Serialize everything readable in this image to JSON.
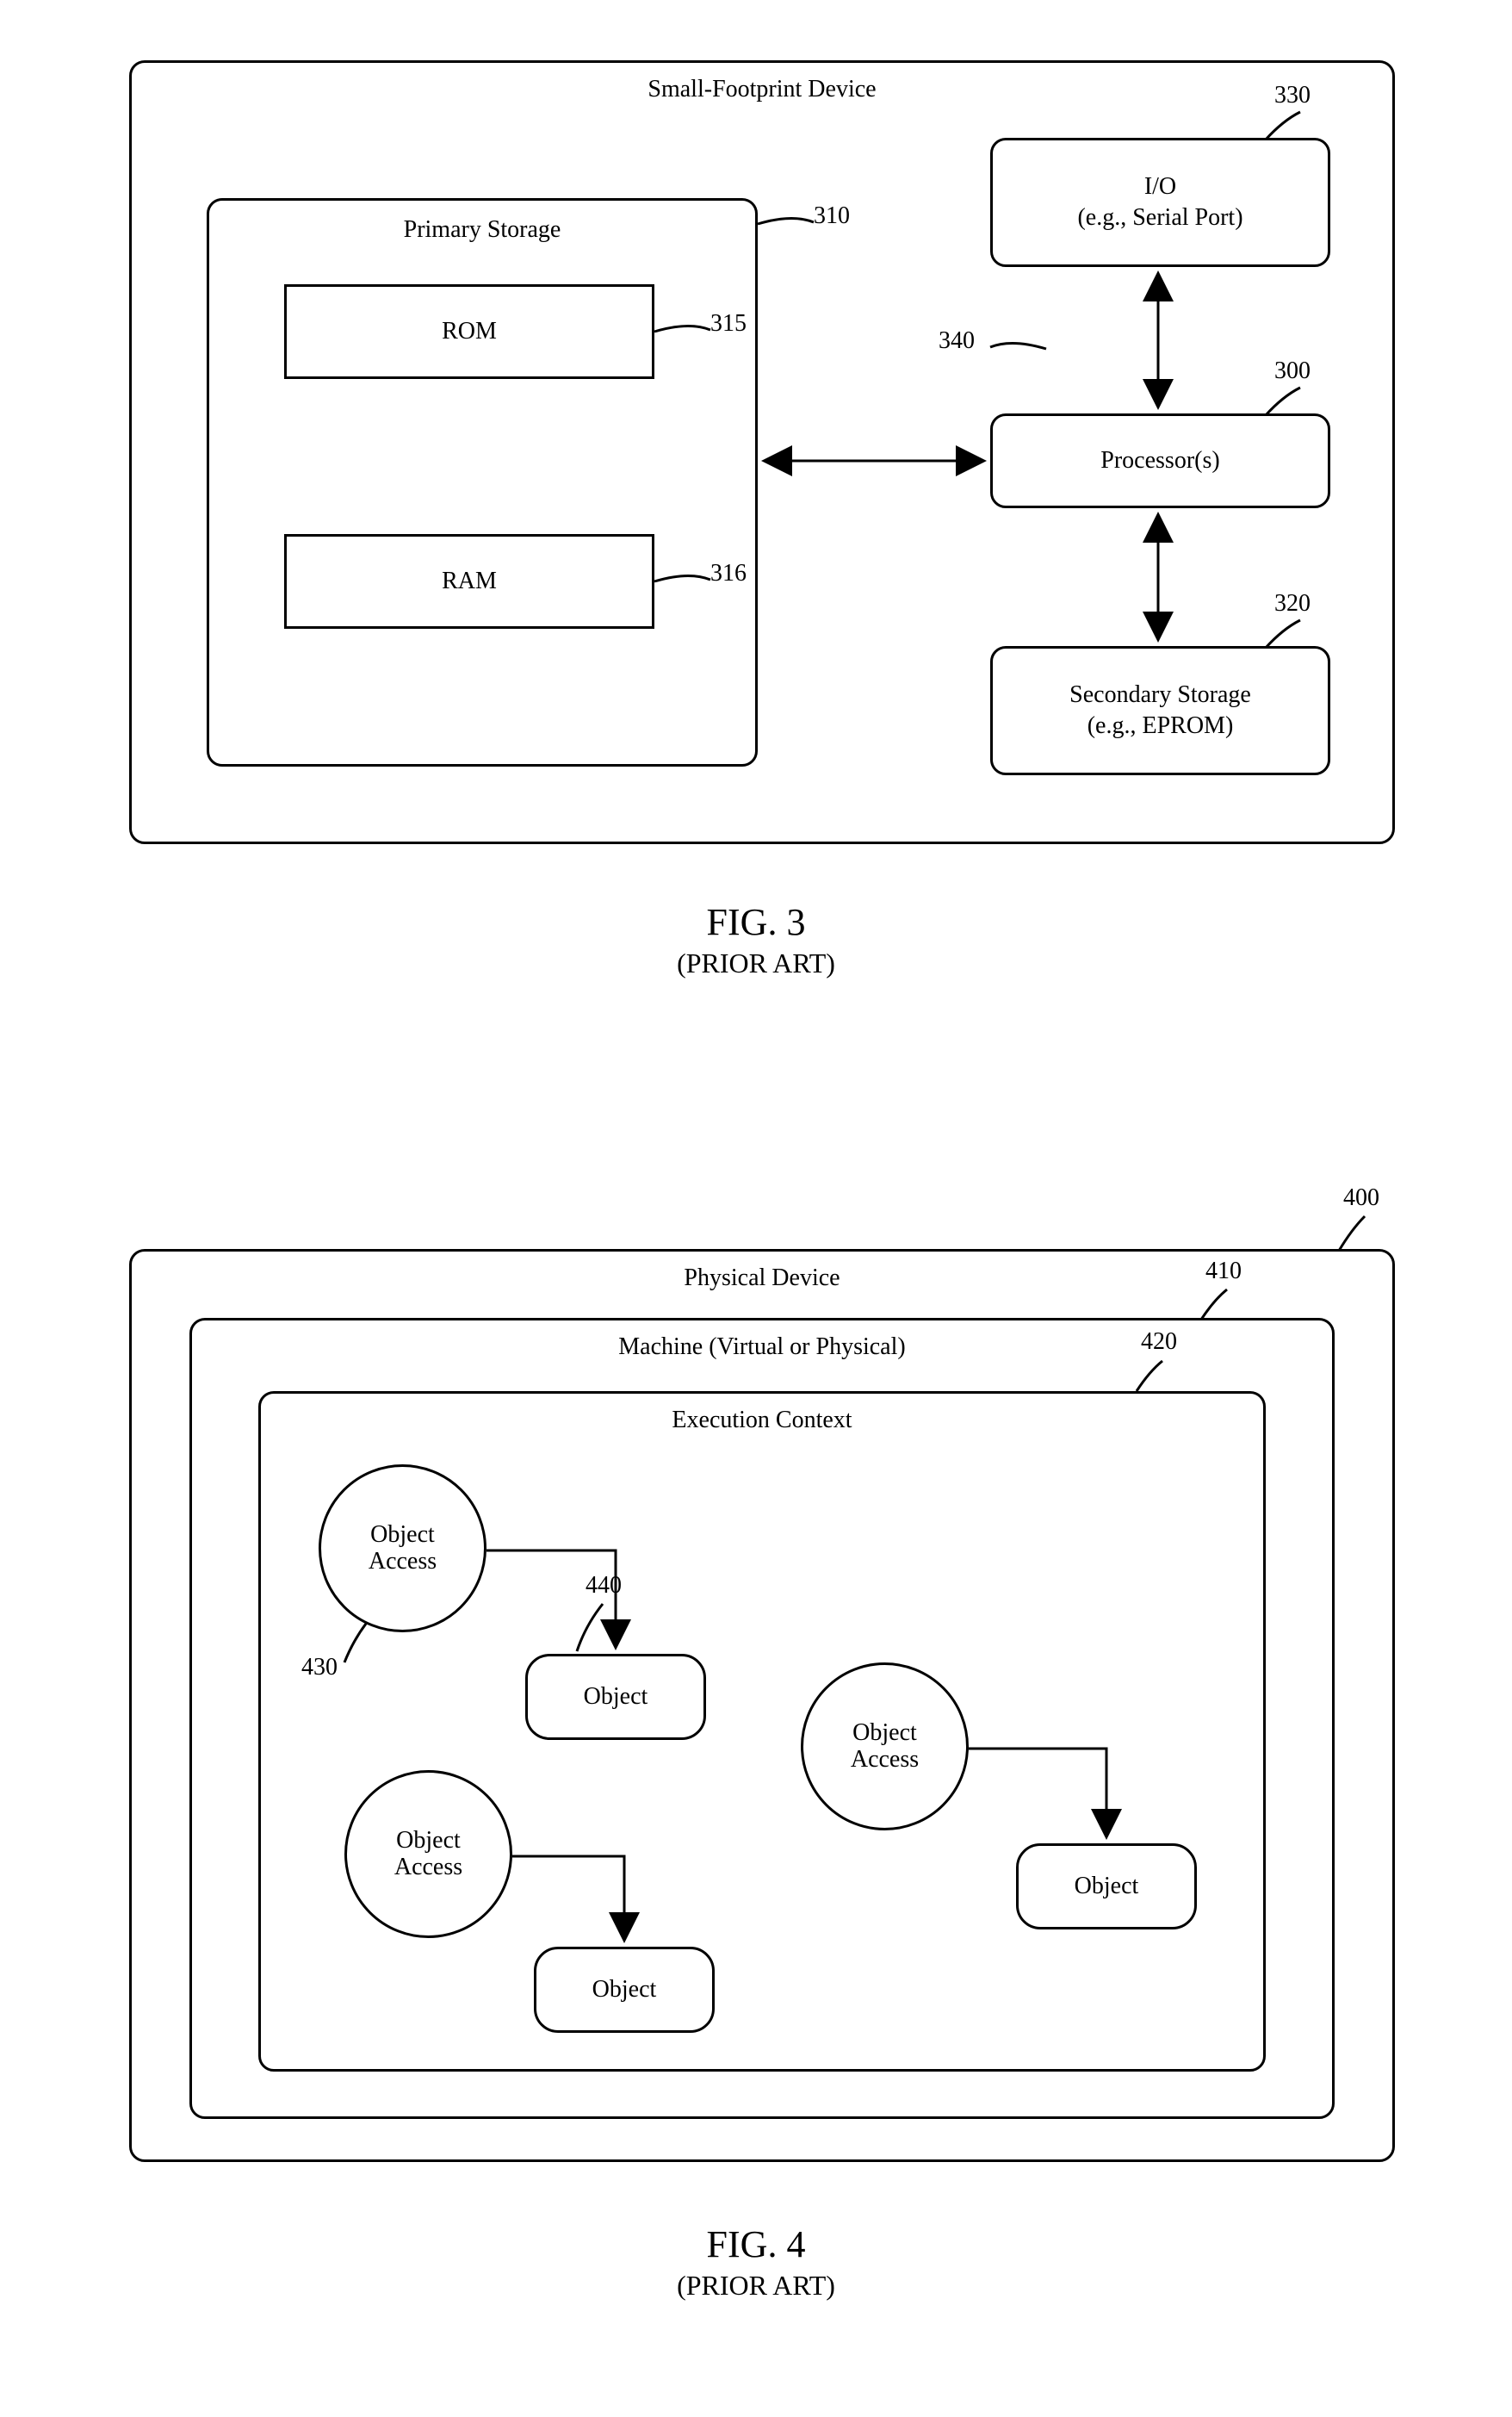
{
  "fig3": {
    "outer_title": "Small-Footprint Device",
    "primary_storage_title": "Primary Storage",
    "rom": "ROM",
    "ram": "RAM",
    "io": "I/O\n(e.g., Serial Port)",
    "processor": "Processor(s)",
    "secondary": "Secondary Storage\n(e.g., EPROM)",
    "ref_300": "300",
    "ref_310": "310",
    "ref_315": "315",
    "ref_316": "316",
    "ref_320": "320",
    "ref_330": "330",
    "ref_340": "340",
    "caption": "FIG. 3",
    "subcap": "(PRIOR ART)"
  },
  "fig4": {
    "ref_400": "400",
    "physical_device": "Physical Device",
    "ref_410": "410",
    "machine": "Machine (Virtual or Physical)",
    "ref_420": "420",
    "execution_context": "Execution Context",
    "object_access": "Object\nAccess",
    "object": "Object",
    "ref_430": "430",
    "ref_440": "440",
    "caption": "FIG. 4",
    "subcap": "(PRIOR ART)"
  }
}
